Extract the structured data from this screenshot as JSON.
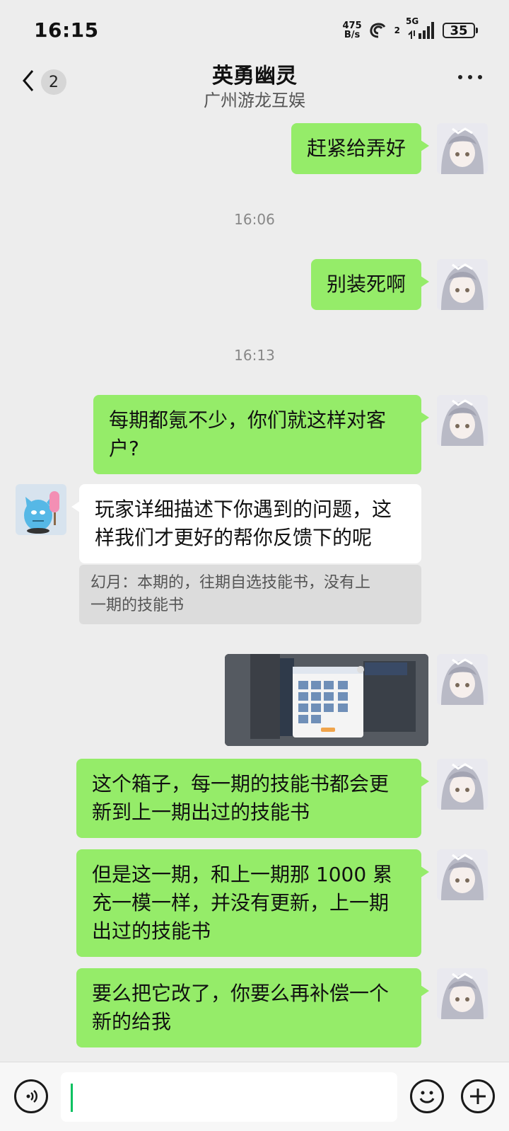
{
  "status_bar": {
    "time": "16:15",
    "net_speed_value": "475",
    "net_speed_unit": "B/s",
    "hd_label": "2",
    "network": "5G",
    "battery": "35"
  },
  "nav": {
    "unread_count": "2",
    "title": "英勇幽灵",
    "subtitle": "广州游龙互娱"
  },
  "messages": {
    "m1": "赶紧给弄好",
    "t1": "16:06",
    "m2": "别装死啊",
    "t2": "16:13",
    "m3_line1": "每期都氪不少，你们就这样对客",
    "m3_line2": "户?",
    "r1_line1": "玩家详细描述下你遇到的问题，这",
    "r1_line2": "样我们才更好的帮你反馈下的呢",
    "quote_line1": "幻月：本期的，往期自选技能书，没有上",
    "quote_line2": "一期的技能书",
    "m4_line1": "这个箱子，每一期的技能书都会更",
    "m4_line2": "新到上一期出过的技能书",
    "m5_line1": "但是这一期，和上一期那 1000 累",
    "m5_line2": "充一模一样，并没有更新，上一期",
    "m5_line3": "出过的技能书",
    "m6_line1": "要么把它改了，你要么再补偿一个",
    "m6_line2": "新的给我"
  },
  "colors": {
    "my_bubble": "#95ec69",
    "their_bubble": "#ffffff",
    "background": "#ededed"
  },
  "icons": {
    "back": "chevron-left-icon",
    "more": "more-dots-icon",
    "voice": "voice-icon",
    "emoji": "emoji-icon",
    "plus": "plus-icon"
  }
}
